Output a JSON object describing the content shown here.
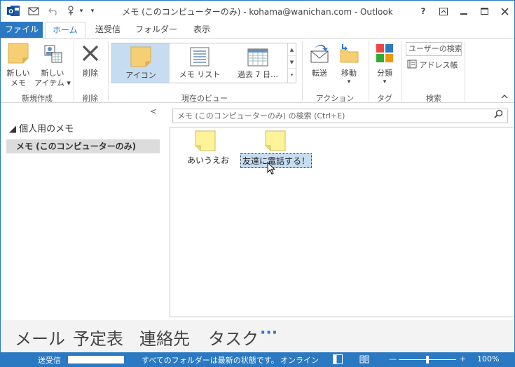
{
  "window": {
    "title": "メモ (このコンピューターのみ) - kohama@wanichan.com - Outlook",
    "controls": {
      "help": "?",
      "restore": "⧉",
      "minimize": "—",
      "maximize": "☐",
      "close": "✕"
    }
  },
  "tabs": [
    {
      "label": "ファイル"
    },
    {
      "label": "ホーム"
    },
    {
      "label": "送受信"
    },
    {
      "label": "フォルダー"
    },
    {
      "label": "表示"
    }
  ],
  "ribbon": {
    "new_memo": "新しい\nメモ",
    "new_memo_l1": "新しい",
    "new_memo_l2": "メモ",
    "new_item_l1": "新しい",
    "new_item_l2": "アイテム ▾",
    "group_new": "新規作成",
    "delete": "削除",
    "group_delete": "削除",
    "view_icon": "アイコン",
    "view_list": "メモ リスト",
    "view_7days": "過去 7 日…",
    "group_view": "現在のビュー",
    "forward": "転送",
    "move": "移動",
    "move_arrow": "▾",
    "group_action": "アクション",
    "categorize": "分類",
    "categorize_arrow": "▾",
    "group_tag": "タグ",
    "search_people": "ユーザーの検索",
    "address_book": "アドレス帳",
    "group_search": "検索",
    "collapse": "^"
  },
  "navpane": {
    "collapse": "<",
    "folder": "◢ 個人用のメモ",
    "item": "メモ (このコンピューターのみ)"
  },
  "search": {
    "placeholder": "メモ (このコンピューターのみ) の検索 (Ctrl+E)"
  },
  "notes": [
    {
      "label": "あいうえお",
      "selected": false
    },
    {
      "label": "友達に電話する！",
      "selected": true
    }
  ],
  "bottomnav": {
    "mail": "メール",
    "calendar": "予定表",
    "contacts": "連絡先",
    "tasks": "タスク",
    "more": "···"
  },
  "status": {
    "sendreceive": "送受信",
    "progress": 1.0,
    "folders": "すべてのフォルダーは最新の状態です。",
    "online": "オンライン",
    "zoom": "100%"
  },
  "colors": {
    "accent": "#2b79c2",
    "note_yellow": "#fff399",
    "selection": "#c5dcf1"
  }
}
